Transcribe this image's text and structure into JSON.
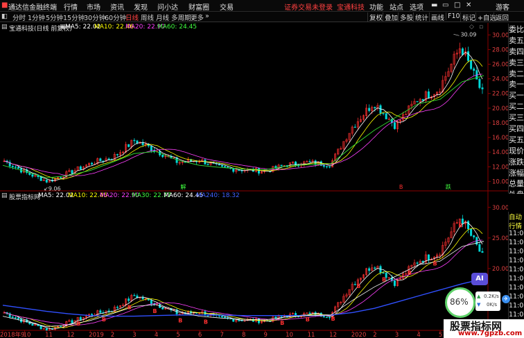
{
  "menubar": {
    "app_name": "通达信金融终端",
    "items": [
      "行情",
      "市场",
      "资讯",
      "发现",
      "问小达",
      "财富圈",
      "交易"
    ],
    "notice": "证券交易未登录",
    "stock_link": "宝通科技",
    "right_items": [
      "功能",
      "站点",
      "选项"
    ],
    "guest": "游客"
  },
  "toolbar": {
    "periods": [
      "分时",
      "1分钟",
      "5分钟",
      "15分钟",
      "30分钟",
      "60分钟",
      "日线",
      "周线",
      "月线",
      "多周期",
      "更多"
    ],
    "active_period": "日线",
    "right_buttons": [
      "复权",
      "叠加",
      "多股",
      "统计",
      "画线",
      "F10",
      "标记",
      "+自选",
      "返回"
    ]
  },
  "panel1": {
    "title": "宝通科技(日线 前复权)",
    "ma": [
      {
        "label": "MA5: 22.02",
        "color": "#ffffff"
      },
      {
        "label": "MA10: 22.46",
        "color": "#ffff00"
      },
      {
        "label": "MA20: 22.90",
        "color": "#ff40ff"
      },
      {
        "label": "MA60: 24.45",
        "color": "#40ff40"
      }
    ],
    "y_ticks": [
      "30.00",
      "28.00",
      "26.00",
      "24.00",
      "22.00",
      "20.00",
      "18.00",
      "16.00",
      "14.00",
      "12.00",
      "10.00"
    ],
    "high_label": "30.09",
    "low_label": "9.06",
    "markers": [
      "解",
      "B",
      "跌"
    ]
  },
  "panel2": {
    "title": "股票指标网",
    "ma": [
      {
        "label": "MA5: 22.02",
        "color": "#ffffff"
      },
      {
        "label": "MA10: 22.46",
        "color": "#ffff00"
      },
      {
        "label": "MA20: 22.90",
        "color": "#ff40ff"
      },
      {
        "label": "MA30: 22.77",
        "color": "#40ff40"
      },
      {
        "label": "MA60: 24.45",
        "color": "#ffffff"
      },
      {
        "label": "MA240: 18.32",
        "color": "#4060ff"
      }
    ],
    "y_ticks": [
      "30.00",
      "25.00",
      "20.00",
      "15.00"
    ],
    "b_label": "B"
  },
  "x_axis": [
    "2018年9",
    "10",
    "11",
    "12",
    "2019",
    "2",
    "3",
    "4",
    "5",
    "6",
    "7",
    "8",
    "9",
    "10",
    "11",
    "12",
    "2020",
    "2",
    "3",
    "4",
    "5",
    "6",
    "7"
  ],
  "right_panel": {
    "rows": [
      "委比",
      "卖五",
      "卖四",
      "卖三",
      "卖二",
      "卖一",
      "买一",
      "买二",
      "买三",
      "买四",
      "买五",
      "现价",
      "涨跌",
      "涨幅",
      "总量",
      "外盘",
      "换手",
      "净资",
      "收益"
    ],
    "rows2": [
      "自动",
      "行情",
      "11:01",
      "11:01",
      "11:01",
      "11:02",
      "11:02",
      "11:02",
      "11:02",
      "11:02",
      "11:02",
      "11:02",
      "11:02",
      "11:02"
    ]
  },
  "overlay": {
    "ai": "AI",
    "speed_percent": "86%",
    "up_speed": "0.2K/s",
    "down_speed": "0K/s",
    "watermark_title": "股票指标网",
    "watermark_url": "www.7gpzb.com"
  },
  "chart_data": [
    {
      "type": "line",
      "title": "宝通科技(日线 前复权)",
      "x": [
        "2018-09",
        "2018-10",
        "2018-11",
        "2018-12",
        "2019-01",
        "2019-02",
        "2019-03",
        "2019-04",
        "2019-05",
        "2019-06",
        "2019-07",
        "2019-08",
        "2019-09",
        "2019-10",
        "2019-11",
        "2019-12",
        "2020-01",
        "2020-02",
        "2020-03",
        "2020-04",
        "2020-05",
        "2020-06",
        "2020-07"
      ],
      "series": [
        {
          "name": "MA60",
          "values": [
            12.2,
            11.4,
            10.5,
            10.8,
            11.5,
            12.6,
            13.8,
            14.1,
            12.9,
            12.2,
            11.9,
            11.7,
            11.6,
            12.1,
            12.3,
            12.4,
            14.8,
            17.0,
            18.8,
            20.6,
            21.2,
            23.6,
            24.45
          ]
        }
      ],
      "close": [
        12.8,
        11.2,
        10.0,
        11.2,
        12.5,
        13.3,
        15.6,
        14.2,
        12.6,
        12.9,
        11.8,
        11.6,
        11.4,
        12.3,
        12.6,
        12.3,
        17.4,
        20.8,
        17.6,
        21.2,
        22.6,
        28.5,
        22.0
      ],
      "ylim": [
        9,
        30.5
      ],
      "high": 30.09,
      "low": 9.06
    },
    {
      "type": "line",
      "title": "股票指标网",
      "series": [
        {
          "name": "MA240",
          "values": [
            14.0,
            13.5,
            13.0,
            12.6,
            12.3,
            12.2,
            12.2,
            12.3,
            12.4,
            12.4,
            12.4,
            12.3,
            12.3,
            12.3,
            12.3,
            12.4,
            12.8,
            13.5,
            14.5,
            15.5,
            16.5,
            17.5,
            18.32
          ]
        }
      ],
      "ylim": [
        10,
        31
      ]
    }
  ]
}
